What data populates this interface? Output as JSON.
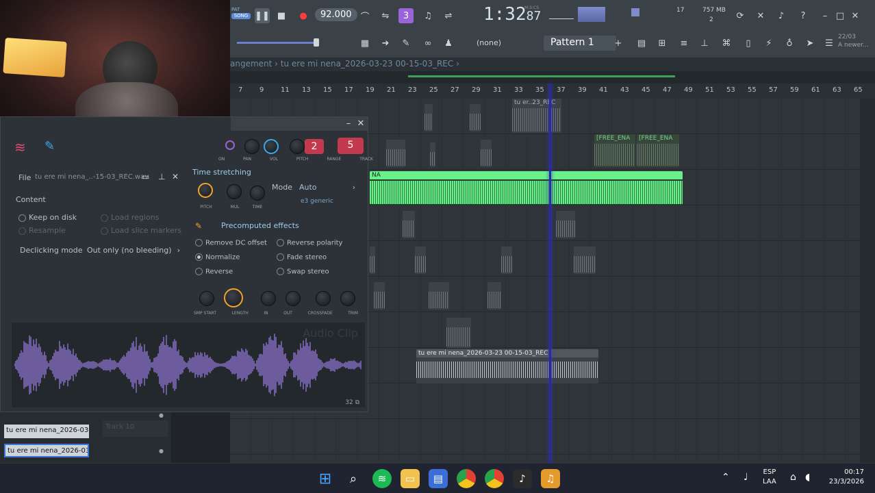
{
  "toolbar": {
    "song_mode": "SONG",
    "pat_label": "PAT",
    "tempo": "92.000",
    "time": "1:32",
    "time_ms": "87",
    "time_unit": "M:S:CS",
    "cpu_voices": "17",
    "ram": "757 MB",
    "ram_sub": "2",
    "pattern_none": "(none)",
    "pattern": "Pattern 1",
    "news_date": "22/03",
    "news_text": "A newer..."
  },
  "playlist": {
    "breadcrumb": "angement  ›  tu ere mi nena_2026-03-23 00-15-03_REC  ›",
    "ruler": [
      "7",
      "9",
      "11",
      "13",
      "15",
      "17",
      "19",
      "21",
      "23",
      "25",
      "27",
      "29",
      "31",
      "33",
      "35",
      "37",
      "39",
      "41",
      "43",
      "45",
      "47",
      "49",
      "51",
      "53",
      "55",
      "57",
      "59",
      "61",
      "63",
      "65"
    ],
    "clip_labels": {
      "top": "tu er..23_REC",
      "free1": "[FREE_ENA",
      "free2": "[FREE_ENA",
      "green": "NA",
      "rec": "tu ere mi nena_2026-03-23 00-15-03_REC"
    },
    "track_label": "Track 10",
    "track_items": [
      "tu ere mi nena_2026-03-...",
      "tu ere mi nena_2026-03-..."
    ]
  },
  "channel_settings": {
    "knobs_top": [
      "ON",
      "PAN",
      "VOL",
      "PITCH",
      "RANGE",
      "TRACK"
    ],
    "range_value": "2",
    "track_value": "5",
    "file_label": "File",
    "file_name": "tu ere mi nena_..-15-03_REC.wav",
    "content_title": "Content",
    "keep_on_disk": "Keep on disk",
    "resample": "Resample",
    "load_regions": "Load regions",
    "load_slice_markers": "Load slice markers",
    "declicking_label": "Declicking mode",
    "declicking_value": "Out only (no bleeding)",
    "time_stretching_title": "Time stretching",
    "ts_knobs": [
      "PITCH",
      "MUL",
      "TIME"
    ],
    "mode_label": "Mode",
    "mode_value": "Auto",
    "mode_sub": "e3 generic",
    "precomputed_title": "Precomputed effects",
    "effects_left": [
      "Remove DC offset",
      "Normalize",
      "Reverse"
    ],
    "effects_right": [
      "Reverse polarity",
      "Fade stereo",
      "Swap stereo"
    ],
    "bottom_knobs": [
      "SMP START",
      "LENGTH",
      "IN",
      "OUT",
      "CROSSFADE",
      "TRIM"
    ],
    "audio_clip_watermark": "Audio Clip",
    "zoom": "32"
  },
  "taskbar": {
    "lang_top": "ESP",
    "lang_bottom": "LAA",
    "clock_time": "00:17",
    "clock_date": "23/3/2026"
  },
  "colors": {
    "accent_green": "#69f08a",
    "purple_wave": "#9c7ee8",
    "playhead": "#2a2a9a"
  }
}
